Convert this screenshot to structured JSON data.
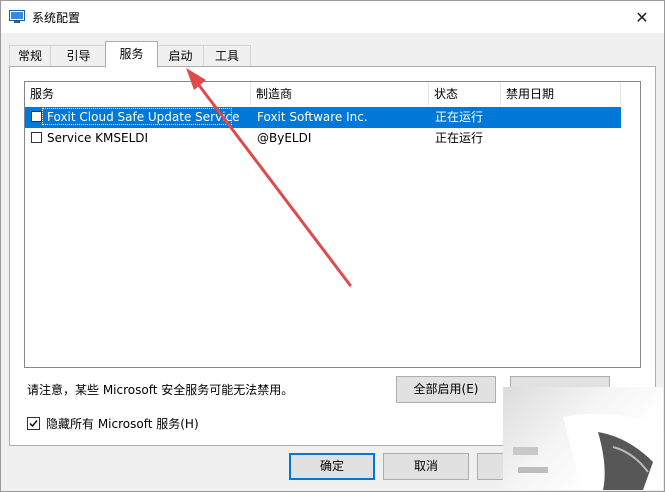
{
  "window": {
    "title": "系统配置"
  },
  "tabs": [
    {
      "label": "常规"
    },
    {
      "label": "引导"
    },
    {
      "label": "服务"
    },
    {
      "label": "启动"
    },
    {
      "label": "工具"
    }
  ],
  "active_tab": "服务",
  "list": {
    "columns": [
      "服务",
      "制造商",
      "状态",
      "禁用日期"
    ],
    "rows": [
      {
        "name": "Foxit Cloud Safe Update Service",
        "vendor": "Foxit Software Inc.",
        "status": "正在运行",
        "date": "",
        "checked": false,
        "selected": true
      },
      {
        "name": "Service KMSELDI",
        "vendor": "@ByELDI",
        "status": "正在运行",
        "date": "",
        "checked": false,
        "selected": false
      }
    ]
  },
  "notice": "请注意，某些 Microsoft 安全服务可能无法禁用。",
  "buttons": {
    "enable_all": "全部启用(E)",
    "ok": "确定",
    "cancel": "取消"
  },
  "hide_ms": {
    "label": "隐藏所有 Microsoft 服务(H)",
    "checked": true
  },
  "annotation": {
    "arrow_color": "#e04a4a"
  },
  "colors": {
    "selection": "#0078d7",
    "default_button_border": "#0078d7"
  }
}
